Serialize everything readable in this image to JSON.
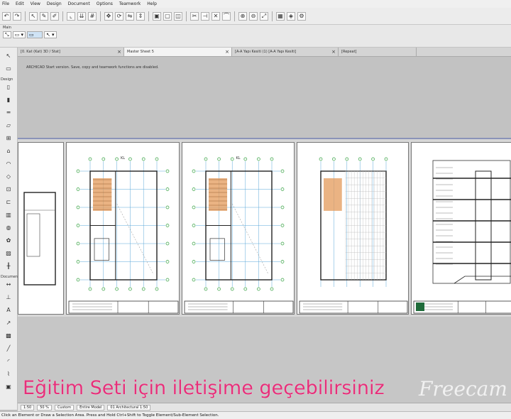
{
  "menu": [
    "File",
    "Edit",
    "View",
    "Design",
    "Document",
    "Options",
    "Teamwork",
    "Help"
  ],
  "info_label": "Main",
  "toolbox": {
    "sections": [
      "Design",
      "Document"
    ],
    "tools": [
      "arrow-tool",
      "marquee-tool",
      "wall-tool",
      "column-tool",
      "beam-tool",
      "slab-tool",
      "stair-tool",
      "roof-tool",
      "shell-tool",
      "mesh-tool",
      "window-tool",
      "door-tool",
      "curtain-wall-tool",
      "morph-tool",
      "object-tool",
      "zone-tool",
      "railing-tool",
      "dimension-tool",
      "level-tool",
      "text-tool",
      "label-tool",
      "fill-tool",
      "line-tool",
      "arc-tool",
      "polyline-tool",
      "drawing-tool"
    ]
  },
  "tabs": [
    {
      "label": "[0. Kat (Kat) 3D / Stat]",
      "active": false
    },
    {
      "label": "Master Sheet 5",
      "active": true
    },
    {
      "label": "[A-A Yapı Kesiti (1) [A-A Yapı Kesiti]",
      "active": false
    },
    {
      "label": "[Repeat]",
      "active": false
    }
  ],
  "message": "ARCHICAD Start version. Save, copy and teamwork functions are disabled.",
  "sheets": [
    {
      "title": "KL"
    },
    {
      "title": "KL"
    },
    {
      "title": ""
    },
    {
      "title": ""
    }
  ],
  "bottom": {
    "scale": "1:50",
    "zoom": "50 %",
    "layers": "Custom",
    "model": "Entire Model",
    "pen_set": "01 Architectural 1:50"
  },
  "caption": "Eğitim Seti için iletişime geçebilirsiniz",
  "watermark": "Freecam",
  "status": "Click an Element or Draw a Selection Area. Press and Hold Ctrl+Shift to Toggle Element/Sub-Element Selection.",
  "colors": {
    "caption": "#e6307a",
    "grid_line": "#5aa7d8",
    "axis_bubble": "#2e9e3a",
    "stair_fill": "#e39a5a",
    "sheet_border": "#7f8bb5"
  }
}
